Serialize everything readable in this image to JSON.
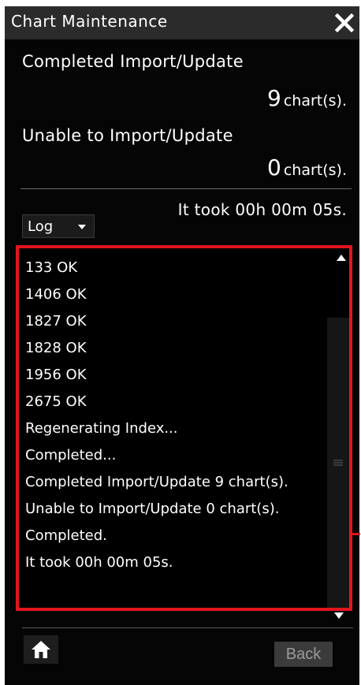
{
  "window": {
    "title": "Chart Maintenance",
    "close_icon": "close-icon"
  },
  "summary": {
    "completed_label": "Completed Import/Update",
    "completed_count": "9",
    "completed_unit": "chart(s).",
    "unable_label": "Unable to Import/Update",
    "unable_count": "0",
    "unable_unit": "chart(s).",
    "duration": "It took 00h 00m 05s."
  },
  "log_select": {
    "value": "Log",
    "icon": "chevron-down-icon"
  },
  "log_entries": [
    "133 OK",
    "1406 OK",
    "1827 OK",
    "1828 OK",
    "1956 OK",
    "2675 OK",
    "Regenerating Index...",
    "Completed...",
    "Completed Import/Update 9 chart(s).",
    "Unable to Import/Update 0 chart(s).",
    "Completed.",
    "It took 00h 00m 05s."
  ],
  "footer": {
    "home_icon": "home-icon",
    "back_label": "Back"
  },
  "colors": {
    "highlight": "#e3151d",
    "background": "#050505",
    "title_bar": "#2b2b2b"
  }
}
